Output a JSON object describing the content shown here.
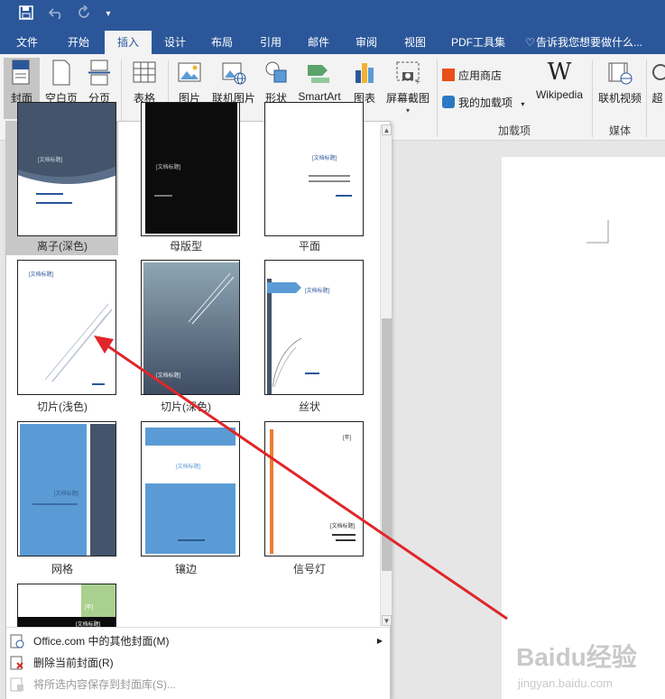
{
  "qat": {
    "save_icon": "save-icon",
    "undo_icon": "undo-icon",
    "redo_icon": "redo-icon",
    "customize_icon": "customize-qat-icon"
  },
  "tabs": [
    {
      "label": "文件"
    },
    {
      "label": "开始"
    },
    {
      "label": "插入"
    },
    {
      "label": "设计"
    },
    {
      "label": "布局"
    },
    {
      "label": "引用"
    },
    {
      "label": "邮件"
    },
    {
      "label": "审阅"
    },
    {
      "label": "视图"
    },
    {
      "label": "PDF工具集"
    }
  ],
  "tellme": "告诉我您想要做什么...",
  "ribbon": {
    "cover": "封面",
    "blank_page": "空白页",
    "page_break": "分页",
    "table": "表格",
    "picture": "图片",
    "online_picture": "联机图片",
    "shapes": "形状",
    "smartart": "SmartArt",
    "chart": "图表",
    "screenshot": "屏幕截图",
    "store": "应用商店",
    "my_addins": "我的加载项",
    "wikipedia": "Wikipedia",
    "wiki_logo": "W",
    "online_video": "联机视频",
    "more": "超",
    "group_addins": "加载项",
    "group_media": "媒体"
  },
  "gallery": {
    "items": [
      {
        "caption": "离子(深色)",
        "selected": true,
        "title": "[文档标题]"
      },
      {
        "caption": "母版型",
        "title": "[文档标题]"
      },
      {
        "caption": "平面",
        "title": "[文档标题]"
      },
      {
        "caption": "切片(浅色)",
        "title": "[文档标题]"
      },
      {
        "caption": "切片(深色)",
        "title": "[文档标题]"
      },
      {
        "caption": "丝状",
        "title": "[文档标题]"
      },
      {
        "caption": "网格",
        "title": "[文档标题]"
      },
      {
        "caption": "镶边",
        "title": "[文档标题]"
      },
      {
        "caption": "信号灯",
        "title": "[文档标题]",
        "year": "[年]"
      },
      {
        "caption": "",
        "title": "[文档标题]",
        "year": "[年]"
      }
    ],
    "footer": {
      "more": "Office.com 中的其他封面(M)",
      "remove": "删除当前封面(R)",
      "save": "将所选内容保存到封面库(S)..."
    }
  },
  "watermark": {
    "brand": "Baidu经验",
    "url": "jingyan.baidu.com"
  },
  "colors": {
    "brand": "#2b579a",
    "arrow": "#e0262a",
    "accent_blue": "#5b9bd5"
  }
}
